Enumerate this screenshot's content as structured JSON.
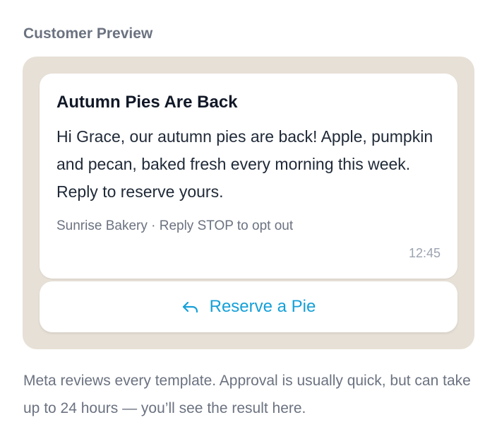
{
  "section": {
    "label": "Customer Preview"
  },
  "message": {
    "title": "Autumn Pies Are Back",
    "body": "Hi Grace, our autumn pies are back! Apple, pumpkin and pecan, baked fresh every morning this week. Reply to reserve yours.",
    "footer": "Sunrise Bakery · Reply STOP to opt out",
    "time": "12:45"
  },
  "quick_reply": {
    "icon": "reply-arrow-icon",
    "label": "Reserve a Pie",
    "color": "#15a0d8"
  },
  "help": {
    "text": "Meta reviews every template. Approval is usually quick, but can take up to 24 hours — you’ll see the result here."
  },
  "colors": {
    "frame_background": "#e7e0d6",
    "card_background": "#ffffff",
    "muted_text": "#6b7280"
  }
}
